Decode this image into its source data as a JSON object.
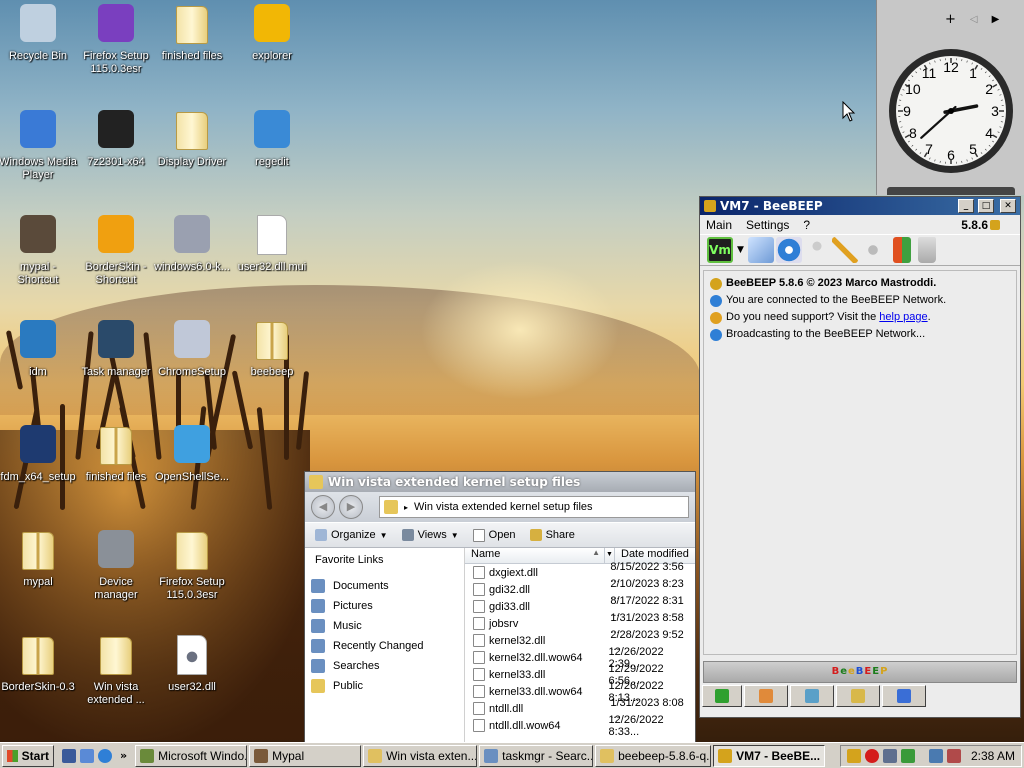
{
  "desktop": {
    "icons": [
      {
        "label": "Recycle Bin",
        "icon": "recycle-bin-icon",
        "col": 0,
        "row": 0
      },
      {
        "label": "Firefox Setup 115.0.3esr",
        "icon": "installer-box-icon",
        "col": 1,
        "row": 0
      },
      {
        "label": "finished files",
        "icon": "folder-icon",
        "col": 2,
        "row": 0
      },
      {
        "label": "explorer",
        "icon": "explorer-folder-icon",
        "col": 3,
        "row": 0
      },
      {
        "label": "Windows Media Player",
        "icon": "media-player-icon",
        "col": 0,
        "row": 1
      },
      {
        "label": "7z2301-x64",
        "icon": "7zip-installer-icon",
        "col": 1,
        "row": 1
      },
      {
        "label": "Display Driver",
        "icon": "folder-icon",
        "col": 2,
        "row": 1
      },
      {
        "label": "regedit",
        "icon": "registry-cubes-icon",
        "col": 3,
        "row": 1
      },
      {
        "label": "mypal - Shortcut",
        "icon": "raccoon-icon",
        "col": 0,
        "row": 2
      },
      {
        "label": "BorderSkin - Shortcut",
        "icon": "borderskin-icon",
        "col": 1,
        "row": 2
      },
      {
        "label": "windows6.0-k...",
        "icon": "msu-package-icon",
        "col": 2,
        "row": 2
      },
      {
        "label": "user32.dll.mui",
        "icon": "blank-file-icon",
        "col": 3,
        "row": 2
      },
      {
        "label": "idm",
        "icon": "idm-icon",
        "col": 0,
        "row": 3
      },
      {
        "label": "Task manager",
        "icon": "task-manager-icon",
        "col": 1,
        "row": 3
      },
      {
        "label": "ChromeSetup",
        "icon": "cd-installer-icon",
        "col": 2,
        "row": 3
      },
      {
        "label": "beebeep",
        "icon": "zip-folder-icon",
        "col": 3,
        "row": 3
      },
      {
        "label": "fdm_x64_setup",
        "icon": "download-arrow-icon",
        "col": 0,
        "row": 4
      },
      {
        "label": "finished files",
        "icon": "zip-folder-icon",
        "col": 1,
        "row": 4
      },
      {
        "label": "OpenShellSe...",
        "icon": "shell-icon",
        "col": 2,
        "row": 4
      },
      {
        "label": "mypal",
        "icon": "zip-folder-icon",
        "col": 0,
        "row": 5
      },
      {
        "label": "Device manager",
        "icon": "device-manager-icon",
        "col": 1,
        "row": 5
      },
      {
        "label": "Firefox Setup 115.0.3esr",
        "icon": "folder-icon",
        "col": 2,
        "row": 5
      },
      {
        "label": "BorderSkin-0.3",
        "icon": "zip-folder-icon",
        "col": 0,
        "row": 6
      },
      {
        "label": "Win vista extended ...",
        "icon": "folder-icon",
        "col": 1,
        "row": 6
      },
      {
        "label": "user32.dll",
        "icon": "gear-file-icon",
        "col": 2,
        "row": 6
      }
    ]
  },
  "gadget": {
    "plus": "+",
    "prev": "◁",
    "next": "▶",
    "clock_hour": 2,
    "clock_minute": 38,
    "numerals": [
      "12",
      "1",
      "2",
      "3",
      "4",
      "5",
      "6",
      "7",
      "8",
      "9",
      "10",
      "11"
    ]
  },
  "beebeep": {
    "title": "VM7 - BeeBEEP",
    "version": "5.8.6",
    "menu": [
      "Main",
      "Settings",
      "?"
    ],
    "btn_min": "_",
    "btn_max": "□",
    "btn_close": "✕",
    "messages": [
      {
        "text": "BeeBEEP 5.8.6 © 2023 Marco Mastroddi.",
        "bold": true
      },
      {
        "text": "You are connected to the BeeBEEP Network."
      },
      {
        "prefix": "Do you need support? Visit the ",
        "link": "help page",
        "suffix": "."
      },
      {
        "text": "Broadcasting to the BeeBEEP Network..."
      }
    ],
    "footer_logo": "BeeBEEP",
    "status_colors": [
      "#d41c1c",
      "#1c7d1c",
      "#d4a31c",
      "#1c4fd4"
    ]
  },
  "explorer": {
    "title": "Win vista extended kernel setup files",
    "address": "Win vista extended kernel setup files",
    "toolbar": {
      "organize": "Organize",
      "views": "Views",
      "open": "Open",
      "share": "Share"
    },
    "nav_header": "Favorite Links",
    "nav": [
      "Documents",
      "Pictures",
      "Music",
      "Recently Changed",
      "Searches",
      "Public"
    ],
    "columns": {
      "name": "Name",
      "date": "Date modified"
    },
    "files": [
      {
        "name": "dxgiext.dll",
        "date": "8/15/2022 3:56 ..."
      },
      {
        "name": "gdi32.dll",
        "date": "2/10/2023 8:23 ..."
      },
      {
        "name": "gdi33.dll",
        "date": "8/17/2022 8:31 ..."
      },
      {
        "name": "jobsrv",
        "date": "1/31/2023 8:58 ..."
      },
      {
        "name": "kernel32.dll",
        "date": "2/28/2023 9:52 ..."
      },
      {
        "name": "kernel32.dll.wow64",
        "date": "12/26/2022 2:39..."
      },
      {
        "name": "kernel33.dll",
        "date": "12/29/2022 6:56..."
      },
      {
        "name": "kernel33.dll.wow64",
        "date": "12/26/2022 8:13..."
      },
      {
        "name": "ntdll.dll",
        "date": "1/31/2023 8:08 ..."
      },
      {
        "name": "ntdll.dll.wow64",
        "date": "12/26/2022 8:33..."
      }
    ]
  },
  "taskbar": {
    "start": "Start",
    "more": "»",
    "tasks": [
      {
        "label": "Microsoft Windo...",
        "color": "#6a8a3a"
      },
      {
        "label": "Mypal",
        "color": "#7a5a3a"
      },
      {
        "label": "Win vista exten...",
        "color": "#e0c060"
      },
      {
        "label": "taskmgr - Searc...",
        "color": "#6a8fc0"
      },
      {
        "label": "beebeep-5.8.6-q...",
        "color": "#e0c060"
      },
      {
        "label": "VM7 - BeeBE...",
        "color": "#d4a31c",
        "active": true
      }
    ],
    "time": "2:38 AM"
  }
}
